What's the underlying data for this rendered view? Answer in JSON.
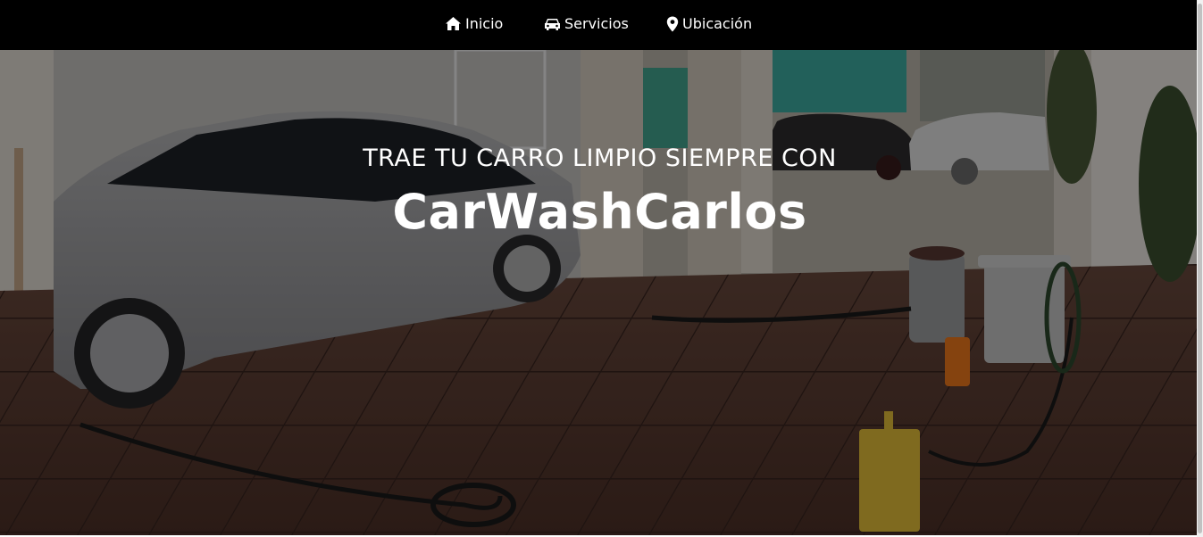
{
  "navbar": {
    "items": [
      {
        "label": "Inicio",
        "icon": "home-icon"
      },
      {
        "label": "Servicios",
        "icon": "car-icon"
      },
      {
        "label": "Ubicación",
        "icon": "map-marker-icon"
      }
    ]
  },
  "hero": {
    "tagline": "TRAE TU CARRO LIMPIO SIEMPRE CON",
    "brand": "CarWashCarlos"
  },
  "colors": {
    "navbar_bg": "#000000",
    "nav_text": "#ffffff",
    "hero_text": "#ffffff"
  }
}
